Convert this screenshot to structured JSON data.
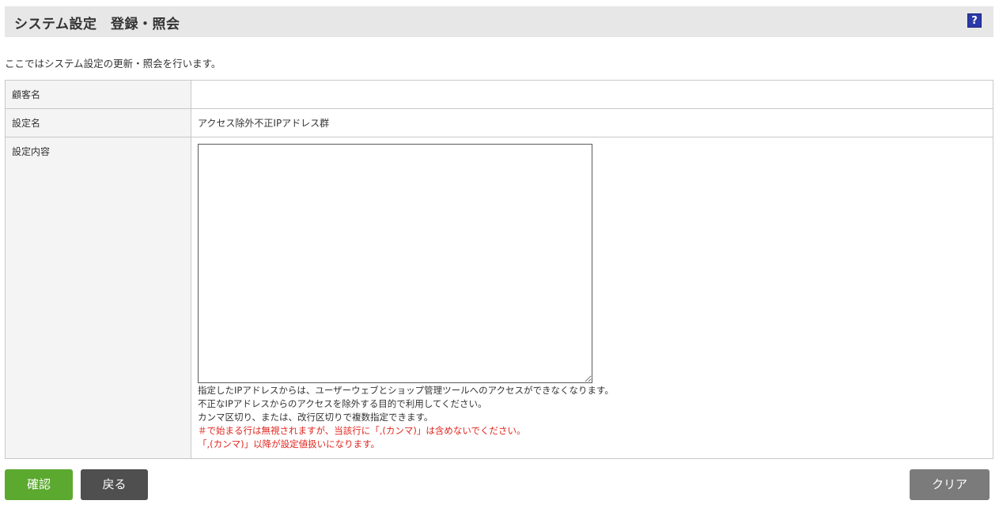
{
  "header": {
    "title": "システム設定　登録・照会",
    "help_label": "?"
  },
  "intro": "ここではシステム設定の更新・照会を行います。",
  "form": {
    "rows": [
      {
        "label": "顧客名",
        "value": ""
      },
      {
        "label": "設定名",
        "value": "アクセス除外不正IPアドレス群"
      },
      {
        "label": "設定内容",
        "value": ""
      }
    ],
    "textarea_value": "",
    "notes": [
      "指定したIPアドレスからは、ユーザーウェブとショップ管理ツールへのアクセスができなくなります。",
      "不正なIPアドレスからのアクセスを除外する目的で利用してください。",
      "カンマ区切り、または、改行区切りで複数指定できます。"
    ],
    "warnings": [
      "＃で始まる行は無視されますが、当該行に「,(カンマ)」は含めないでください。",
      "「,(カンマ)」以降が設定値扱いになります。"
    ]
  },
  "buttons": {
    "confirm": "確認",
    "back": "戻る",
    "clear": "クリア"
  },
  "colors": {
    "confirm": "#5ba92e",
    "back": "#4f4f4f",
    "clear": "#7b7b7b",
    "warning": "#e0261f",
    "help": "#2b3aa8"
  }
}
